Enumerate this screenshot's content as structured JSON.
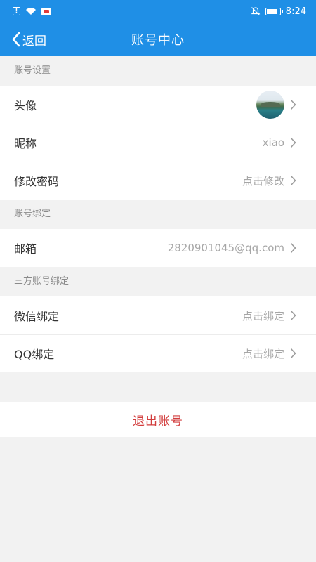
{
  "statusbar": {
    "time": "8:24",
    "icons": [
      "sim-alert-icon",
      "wifi-icon",
      "huawei-app-icon",
      "bell-muted-icon",
      "battery-icon"
    ]
  },
  "navbar": {
    "back_label": "返回",
    "title": "账号中心"
  },
  "sections": {
    "account_settings": {
      "header": "账号设置",
      "avatar_label": "头像",
      "nickname_label": "昵称",
      "nickname_value": "xiao",
      "password_label": "修改密码",
      "password_value": "点击修改"
    },
    "account_binding": {
      "header": "账号绑定",
      "email_label": "邮箱",
      "email_value": "2820901045@qq.com"
    },
    "third_party": {
      "header": "三方账号绑定",
      "wechat_label": "微信绑定",
      "wechat_value": "点击绑定",
      "qq_label": "QQ绑定",
      "qq_value": "点击绑定"
    }
  },
  "logout_label": "退出账号",
  "colors": {
    "accent": "#1f8fe6",
    "danger": "#d23c3c",
    "background": "#f2f2f2"
  }
}
